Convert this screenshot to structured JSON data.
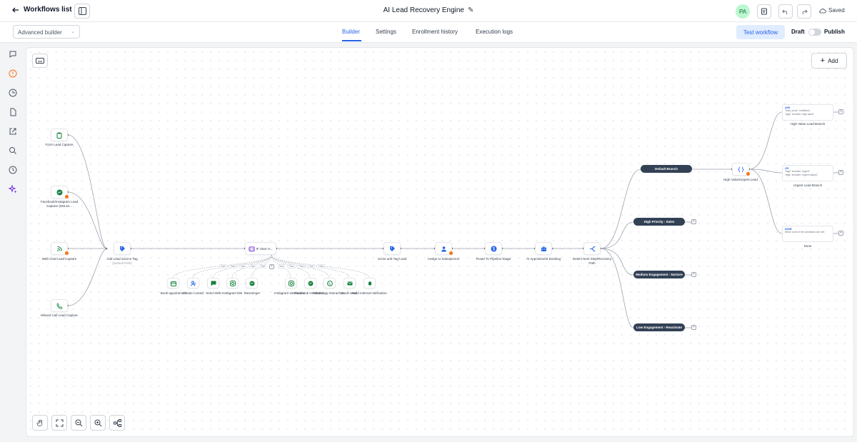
{
  "header": {
    "back_label": "Workflows list",
    "workflow_title": "AI Lead Recovery Engine",
    "avatar_initials": "PA",
    "saved_label": "Saved"
  },
  "subbar": {
    "builder_mode": "Advanced builder",
    "tabs": [
      "Builder",
      "Settings",
      "Enrollment history",
      "Execution logs"
    ],
    "active_tab": "Builder",
    "test_button": "Test workflow",
    "draft_label": "Draft",
    "publish_label": "Publish"
  },
  "canvas": {
    "add_label": "Add",
    "triggers": [
      {
        "label": "Form Lead Capture",
        "icon": "clipboard-icon"
      },
      {
        "label": "Facebook/Instagram Lead Capture (DM an...",
        "icon": "messenger-icon"
      },
      {
        "label": "Web Chat Lead Capture",
        "icon": "rss-icon"
      },
      {
        "label": "Missed Call Lead Capture",
        "icon": "phone-icon"
      }
    ],
    "main_flow": [
      {
        "label": "Add Lead Source Tag",
        "sub": "(Default Path)",
        "icon": "tag-icon"
      },
      {
        "label": "IF Start AI...",
        "icon": "ai-icon"
      },
      {
        "label": "Score and Tag Lead",
        "icon": "tag-icon"
      },
      {
        "label": "Assign to Salesperson",
        "icon": "user-icon"
      },
      {
        "label": "Route To Pipeline Stage",
        "icon": "dollar-icon"
      },
      {
        "label": "AI Appointment Booking",
        "icon": "bot-icon"
      },
      {
        "label": "Detect Next Step/Recovery Path",
        "icon": "split-icon"
      }
    ],
    "tools": [
      {
        "label": "Book appointment",
        "icon": "calendar-icon"
      },
      {
        "label": "Create contact",
        "icon": "contact-icon"
      },
      {
        "label": "Send SMS",
        "icon": "sms-icon"
      },
      {
        "label": "Instagram DM",
        "icon": "instagram-icon"
      },
      {
        "label": "Messenger",
        "icon": "messenger-icon"
      },
      {
        "label": "Instagram Interactive...",
        "icon": "instagram-icon"
      },
      {
        "label": "Facebook Interactive...",
        "icon": "messenger-icon"
      },
      {
        "label": "WhatsApp Interactive...",
        "icon": "whatsapp-icon"
      },
      {
        "label": "Send email",
        "icon": "email-icon"
      },
      {
        "label": "Send internal notification",
        "icon": "bell-icon"
      }
    ],
    "tool_chip_label": "Tool",
    "branches": [
      "Default Branch",
      "High Priority - Sales",
      "Medium Engagement - Nurture",
      "Low Engagement - Reactivate"
    ],
    "decision": {
      "label": "High Value/Urgent Lead",
      "icon": "braces-icon"
    },
    "conditions": [
      {
        "tag": "AND",
        "lines": [
          "\"lead_score\" undefined",
          "\"tags\" includes \"high value\""
        ],
        "label": "High Value Lead Branch"
      },
      {
        "tag": "OR",
        "lines": [
          "\"tags\" includes \"urgent\"",
          "\"tags\" includes \"urgent inquiry\""
        ],
        "label": "Urgent Lead Branch"
      },
      {
        "tag": "NONE",
        "lines": [
          "When none of the conditions are met"
        ],
        "label": "None"
      }
    ]
  },
  "colors": {
    "accent": "#2563eb",
    "pill": "#334155",
    "warn": "#f97316",
    "green": "#15803d"
  }
}
